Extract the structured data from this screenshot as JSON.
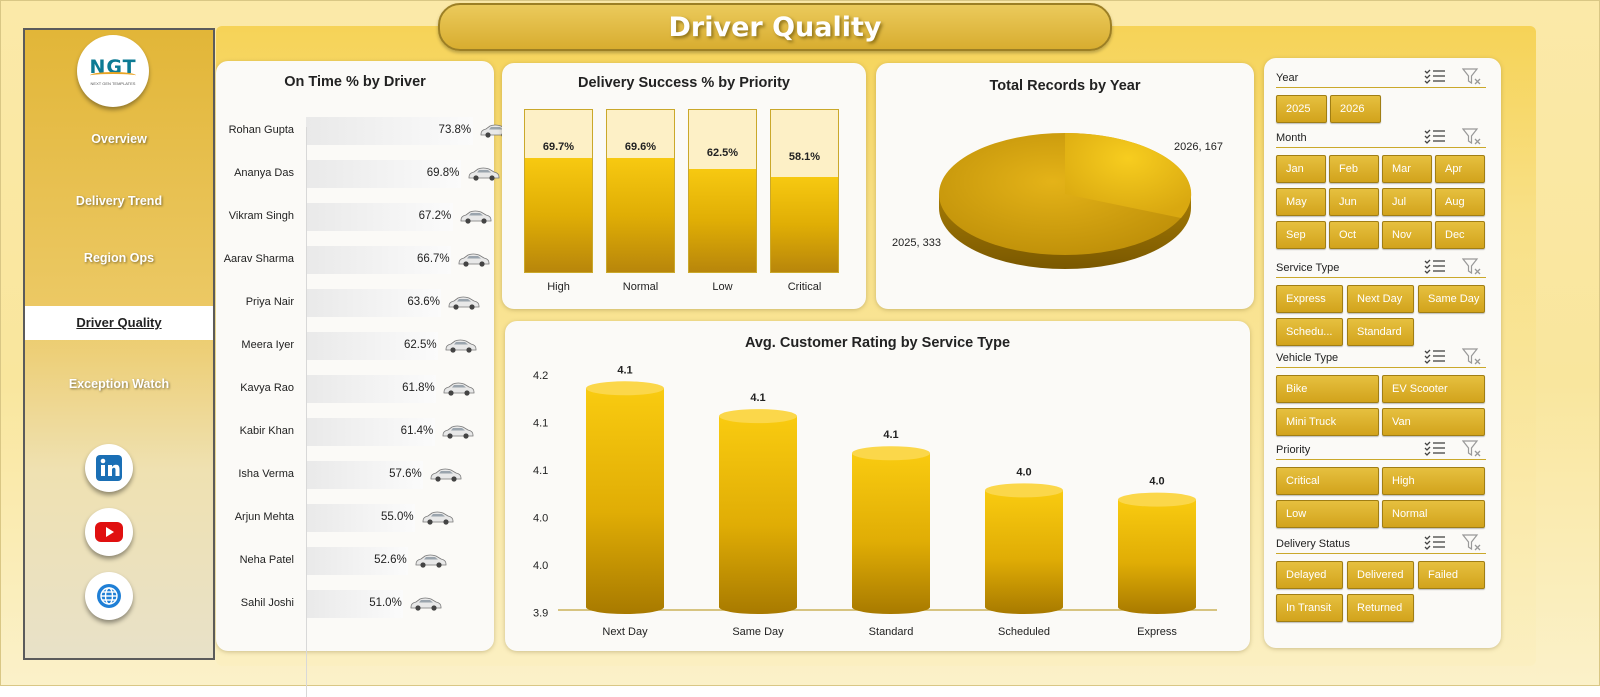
{
  "title": "Driver Quality",
  "logo": {
    "text": "NGT",
    "subtext": "NEXT GEN TEMPLATES"
  },
  "nav": [
    {
      "label": "Overview",
      "active": false
    },
    {
      "label": "Delivery Trend",
      "active": false
    },
    {
      "label": "Region Ops",
      "active": false
    },
    {
      "label": "Driver Quality",
      "active": true
    },
    {
      "label": "Exception Watch",
      "active": false
    }
  ],
  "social": [
    "linkedin-icon",
    "youtube-icon",
    "globe-icon"
  ],
  "charts": {
    "on_time": {
      "title": "On Time % by Driver"
    },
    "priority": {
      "title": "Delivery Success % by Priority"
    },
    "year": {
      "title": "Total Records by Year"
    },
    "rating": {
      "title": "Avg. Customer Rating by Service Type"
    }
  },
  "chart_data": [
    {
      "type": "bar",
      "title": "On Time % by Driver",
      "categories": [
        "Rohan Gupta",
        "Ananya Das",
        "Vikram Singh",
        "Aarav Sharma",
        "Priya Nair",
        "Meera Iyer",
        "Kavya Rao",
        "Kabir Khan",
        "Isha Verma",
        "Arjun Mehta",
        "Neha Patel",
        "Sahil Joshi"
      ],
      "values": [
        73.8,
        69.8,
        67.2,
        66.7,
        63.6,
        62.5,
        61.8,
        61.4,
        57.6,
        55.0,
        52.6,
        51.0
      ],
      "labels": [
        "73.8%",
        "69.8%",
        "67.2%",
        "66.7%",
        "63.6%",
        "62.5%",
        "61.8%",
        "61.4%",
        "57.6%",
        "55.0%",
        "52.6%",
        "51.0%"
      ],
      "orientation": "horizontal"
    },
    {
      "type": "bar",
      "title": "Delivery Success % by Priority",
      "categories": [
        "High",
        "Normal",
        "Low",
        "Critical"
      ],
      "values": [
        69.7,
        69.6,
        62.5,
        58.1
      ],
      "labels": [
        "69.7%",
        "69.6%",
        "62.5%",
        "58.1%"
      ],
      "ylim": [
        0,
        100
      ]
    },
    {
      "type": "pie",
      "title": "Total Records by Year",
      "categories": [
        "2025",
        "2026"
      ],
      "values": [
        333,
        167
      ],
      "labels": [
        "2025, 333",
        "2026, 167"
      ]
    },
    {
      "type": "bar",
      "title": "Avg. Customer Rating by Service Type",
      "categories": [
        "Next Day",
        "Same Day",
        "Standard",
        "Scheduled",
        "Express"
      ],
      "values": [
        4.14,
        4.11,
        4.07,
        4.03,
        4.02
      ],
      "labels": [
        "4.1",
        "4.1",
        "4.1",
        "4.0",
        "4.0"
      ],
      "yticks": [
        "4.2",
        "4.1",
        "4.1",
        "4.0",
        "4.0",
        "3.9"
      ],
      "ylim": [
        3.9,
        4.15
      ]
    }
  ],
  "slicers": [
    {
      "title": "Year",
      "items": [
        "2025",
        "2026"
      ]
    },
    {
      "title": "Month",
      "items": [
        "Jan",
        "Feb",
        "Mar",
        "Apr",
        "May",
        "Jun",
        "Jul",
        "Aug",
        "Sep",
        "Oct",
        "Nov",
        "Dec"
      ]
    },
    {
      "title": "Service Type",
      "items": [
        "Express",
        "Next Day",
        "Same Day",
        "Schedu...",
        "Standard"
      ]
    },
    {
      "title": "Vehicle Type",
      "items": [
        "Bike",
        "EV Scooter",
        "Mini Truck",
        "Van"
      ]
    },
    {
      "title": "Priority",
      "items": [
        "Critical",
        "High",
        "Low",
        "Normal"
      ]
    },
    {
      "title": "Delivery Status",
      "items": [
        "Delayed",
        "Delivered",
        "Failed",
        "In Transit",
        "Returned"
      ]
    }
  ],
  "colors": {
    "accent": "#d9ab1e",
    "bar_top": "#f7c911",
    "bar_bottom": "#b8860b",
    "panel": "#fbfaf7"
  }
}
